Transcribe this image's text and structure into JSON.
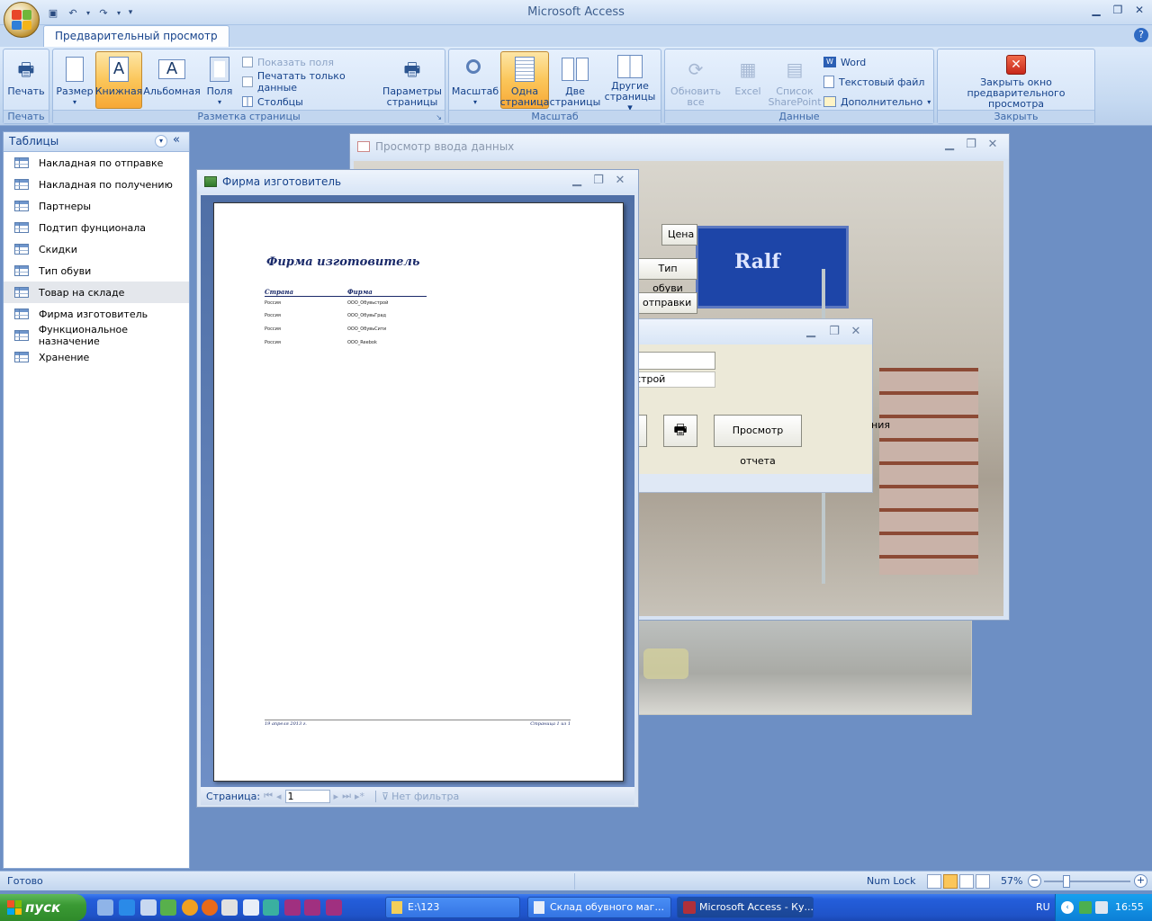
{
  "app": {
    "title": "Microsoft Access"
  },
  "ribbon": {
    "tab": "Предварительный просмотр",
    "groups": {
      "print": {
        "title": "Печать",
        "print_label": "Печать"
      },
      "layout": {
        "title": "Разметка страницы",
        "size": "Размер",
        "portrait": "Книжная",
        "landscape": "Альбомная",
        "margins": "Поля",
        "show_margins": "Показать поля",
        "print_data_only": "Печатать только данные",
        "columns": "Столбцы",
        "page_setup_1": "Параметры",
        "page_setup_2": "страницы"
      },
      "zoom": {
        "title": "Масштаб",
        "zoom": "Масштаб",
        "one_page_1": "Одна",
        "one_page_2": "страница",
        "two_pages_1": "Две",
        "two_pages_2": "страницы",
        "more_pages_1": "Другие",
        "more_pages_2": "страницы"
      },
      "data": {
        "title": "Данные",
        "refresh_1": "Обновить",
        "refresh_2": "все",
        "excel": "Excel",
        "sharepoint_1": "Список",
        "sharepoint_2": "SharePoint",
        "word": "Word",
        "text_file": "Текстовый файл",
        "more": "Дополнительно"
      },
      "close": {
        "title": "Закрыть",
        "close_1": "Закрыть окно",
        "close_2": "предварительного просмотра"
      }
    }
  },
  "nav": {
    "header": "Таблицы",
    "items": [
      "Накладная по отправке",
      "Накладная по получению",
      "Партнеры",
      "Подтип фунционала",
      "Скидки",
      "Тип обуви",
      "Товар на складе",
      "Фирма изготовитель",
      "Функциональное назначение",
      "Хранение"
    ],
    "selected_index": 6
  },
  "windows": {
    "data_entry": {
      "title": "Просмотр ввода данных",
      "btn_price": "Цена",
      "btn_shoe_type": "Тип обуви",
      "btn_shipping": "отправки",
      "photo_sign": "Ralf"
    },
    "dialog": {
      "field2_value": "строй",
      "btn_preview": "Просмотр отчета",
      "partial_label": "ния"
    },
    "report": {
      "title": "Фирма изготовитель",
      "heading": "Фирма изготовитель",
      "col_country": "Страна",
      "col_firm": "Фирма",
      "rows": [
        {
          "country": "Россия",
          "firm": "ООО_Обувьстрой"
        },
        {
          "country": "Россия",
          "firm": "ООО_ОбувьГрад"
        },
        {
          "country": "Россия",
          "firm": "ООО_ОбувьСити"
        },
        {
          "country": "Россия",
          "firm": "ООО_Reebok"
        }
      ],
      "footer_date": "19 апреля 2013 г.",
      "footer_page": "Страница 1 из 1",
      "page_label": "Страница:",
      "page_value": "1",
      "filter": "Нет фильтра"
    }
  },
  "status": {
    "left": "Готово",
    "numlock": "Num Lock",
    "zoom": "57%"
  },
  "taskbar": {
    "start": "пуск",
    "items": [
      "E:\\123",
      "Склад обувного маг...",
      "Microsoft Access - Ку..."
    ],
    "lang": "RU",
    "time": "16:55"
  }
}
